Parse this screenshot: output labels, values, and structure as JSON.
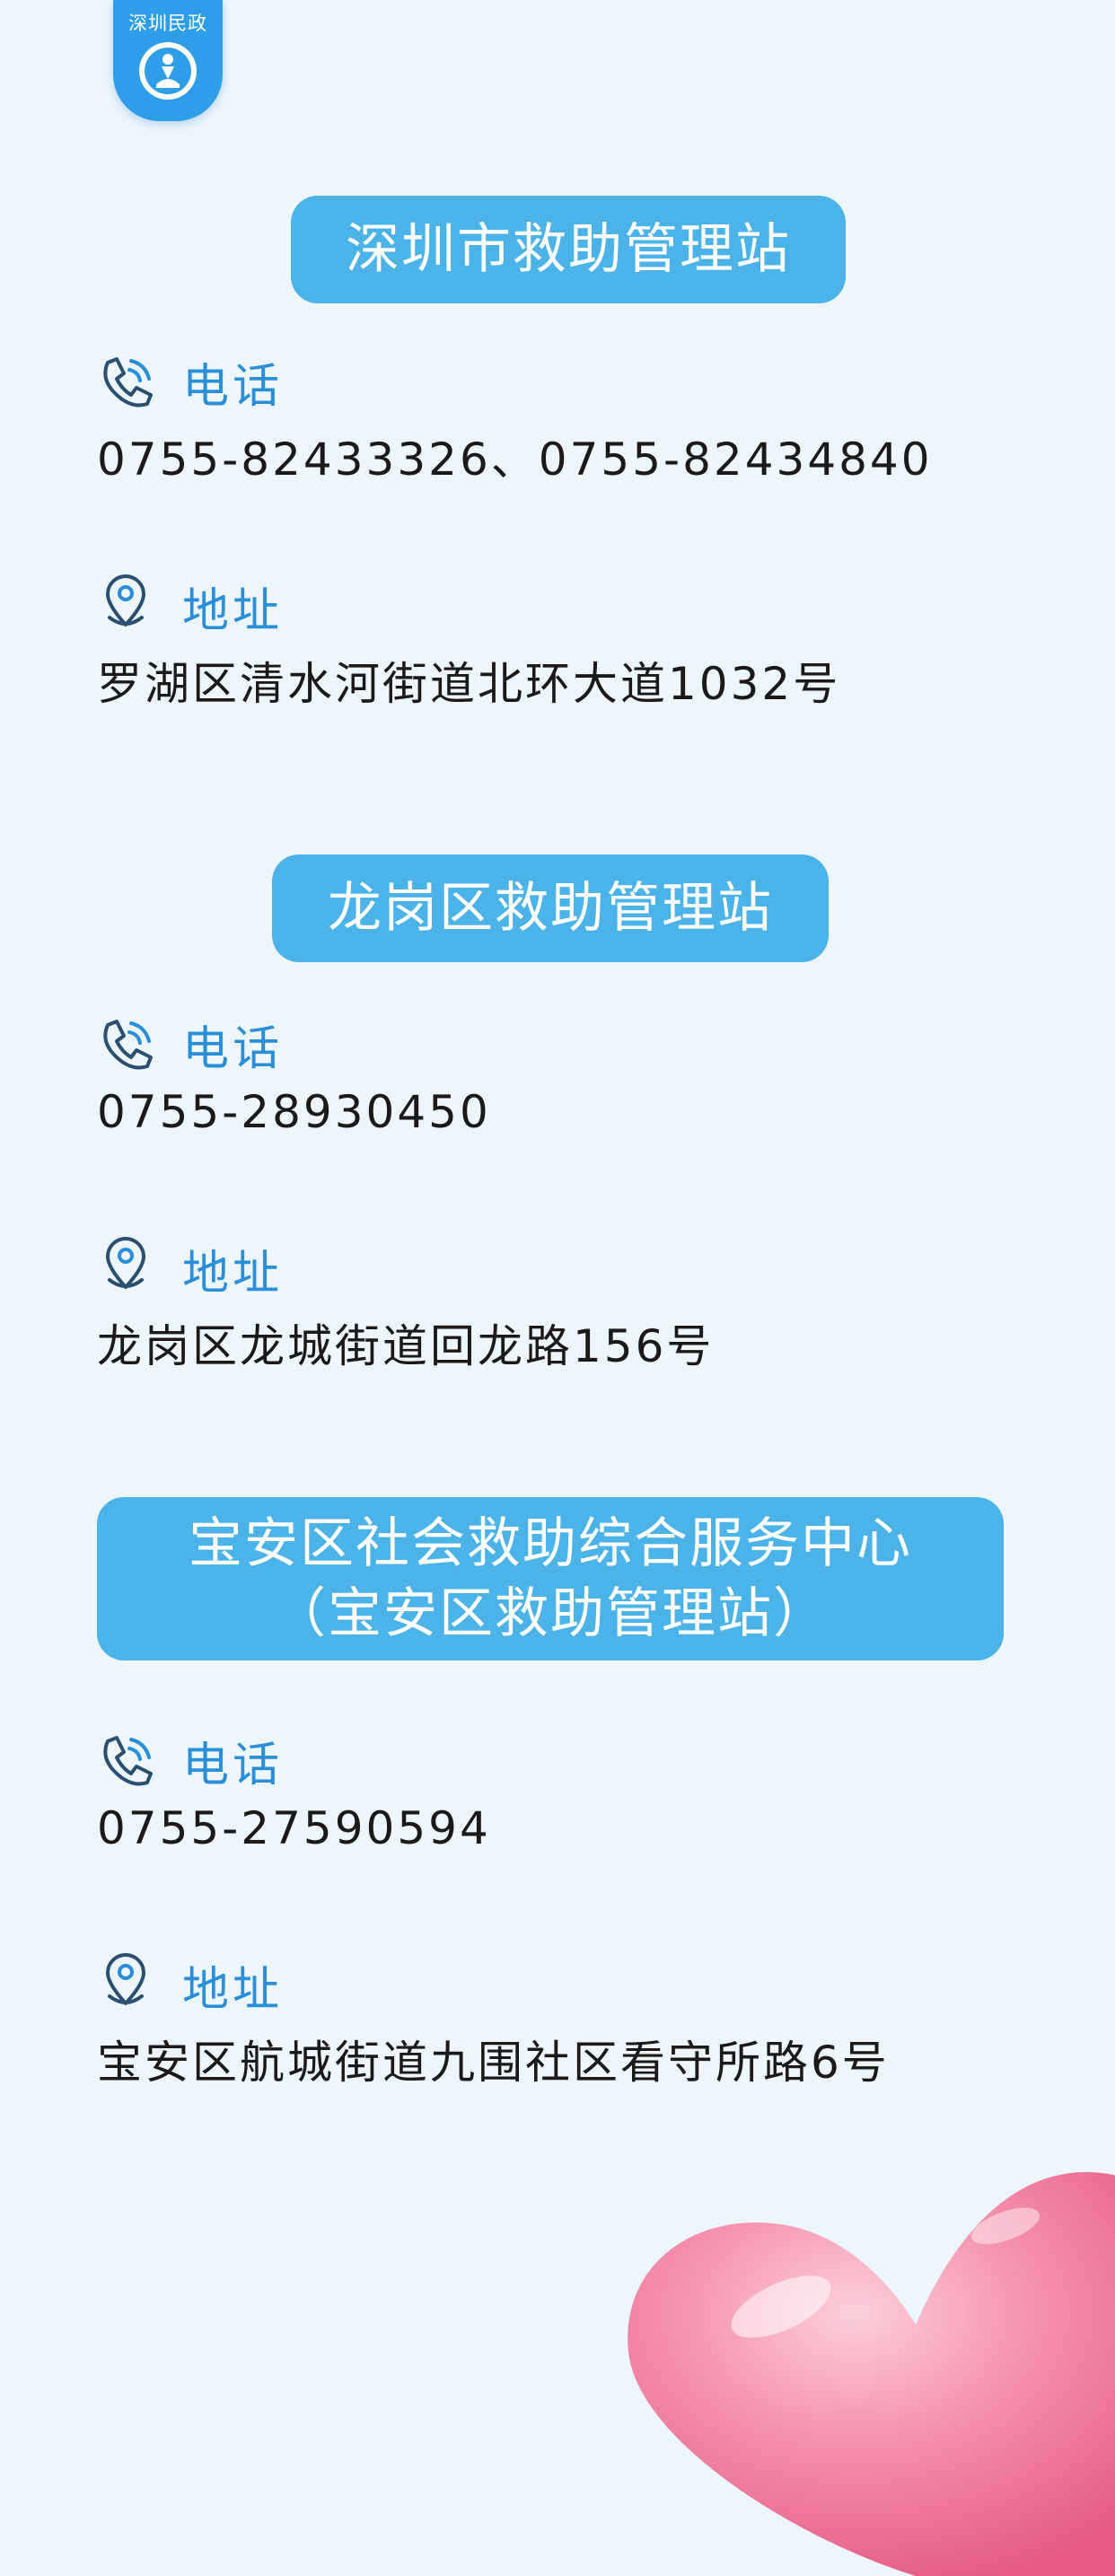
{
  "logo": {
    "text": "深圳民政"
  },
  "stations": [
    {
      "title": "深圳市救助管理站",
      "phone_label": "电话",
      "phone": "0755-82433326、0755-82434840",
      "address_label": "地址",
      "address": "罗湖区清水河街道北环大道1032号"
    },
    {
      "title": "龙岗区救助管理站",
      "phone_label": "电话",
      "phone": "0755-28930450",
      "address_label": "地址",
      "address": "龙岗区龙城街道回龙路156号"
    },
    {
      "title_line1": "宝安区社会救助综合服务中心",
      "title_line2": "（宝安区救助管理站）",
      "phone_label": "电话",
      "phone": "0755-27590594",
      "address_label": "地址",
      "address": "宝安区航城街道九围社区看守所路6号"
    }
  ],
  "colors": {
    "accent": "#4bb3e8",
    "label": "#2a8fd8",
    "background": "#eef6fd",
    "heart": "#f47fa0"
  },
  "icons": [
    "phone-icon",
    "location-pin-icon",
    "logo-emblem-icon",
    "heart-decoration"
  ]
}
